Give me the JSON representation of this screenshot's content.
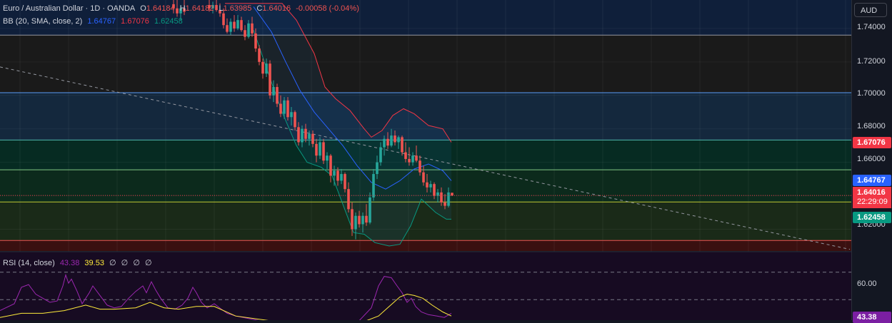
{
  "header": {
    "symbol": "Euro / Australian Dollar · 1D · OANDA",
    "o_label": "O",
    "o_value": "1.64184",
    "h_label": "H",
    "h_value": "1.64182",
    "l_label": "L",
    "l_value": "1.63985",
    "c_label": "C",
    "c_value": "1.64016",
    "change": "-0.00058 (-0.04%)"
  },
  "bb": {
    "label": "BB (20, SMA, close, 2)",
    "basis": "1.64767",
    "upper": "1.67076",
    "lower": "1.62458"
  },
  "rsi": {
    "label": "RSI (14, close)",
    "value": "43.38",
    "ma_value": "39.53",
    "empty1": "∅",
    "empty2": "∅",
    "empty3": "∅",
    "empty4": "∅",
    "axis_label": "60.00",
    "badge": "43.38"
  },
  "price_axis": {
    "currency": "AUD",
    "ticks": [
      "1.74000",
      "1.72000",
      "1.70000",
      "1.68000",
      "1.66000",
      "1.62000"
    ],
    "upper_badge": "1.67076",
    "basis_badge": "1.64767",
    "current_price": "1.64016",
    "countdown": "22:29:09",
    "lower_badge": "1.62458"
  },
  "colors": {
    "background": "#131722",
    "bull": "#26a69a",
    "bear": "#ef5350",
    "bb_upper": "#f23645",
    "bb_basis": "#2962ff",
    "bb_lower": "#089981",
    "rsi": "#9c27b0",
    "rsi_ma": "#ffeb3b"
  },
  "chart_data": {
    "type": "candlestick",
    "instrument": "Euro / Australian Dollar",
    "timeframe": "1D",
    "ylim": [
      1.607,
      1.757
    ],
    "zones": [
      {
        "from": 1.736,
        "to": 1.757,
        "color": "#0f1f3a"
      },
      {
        "from": 1.7016,
        "to": 1.736,
        "color": "#1a1a1a"
      },
      {
        "from": 1.6733,
        "to": 1.7016,
        "color": "#14283d"
      },
      {
        "from": 1.6555,
        "to": 1.6733,
        "color": "#062b22"
      },
      {
        "from": 1.6363,
        "to": 1.6555,
        "color": "#0c2a1c"
      },
      {
        "from": 1.6133,
        "to": 1.6363,
        "color": "#1a2a18"
      },
      {
        "from": 1.607,
        "to": 1.6133,
        "color": "#3a1010"
      }
    ],
    "levels": [
      {
        "price": 1.736,
        "color": "#9598a1"
      },
      {
        "price": 1.7016,
        "color": "#5b9cf6"
      },
      {
        "price": 1.6733,
        "color": "#4db6ac"
      },
      {
        "price": 1.6555,
        "color": "#81c784"
      },
      {
        "price": 1.6363,
        "color": "#c0ca33"
      },
      {
        "price": 1.6133,
        "color": "#ef5350"
      }
    ],
    "trendline": {
      "from": [
        0,
        1.717
      ],
      "to": [
        1190,
        1.608
      ]
    },
    "bb_upper": [
      [
        315,
        1.755
      ],
      [
        370,
        1.755
      ],
      [
        395,
        1.755
      ],
      [
        415,
        1.745
      ],
      [
        440,
        1.725
      ],
      [
        455,
        1.705
      ],
      [
        470,
        1.698
      ],
      [
        490,
        1.691
      ],
      [
        510,
        1.68
      ],
      [
        520,
        1.675
      ],
      [
        535,
        1.679
      ],
      [
        550,
        1.688
      ],
      [
        565,
        1.692
      ],
      [
        580,
        1.689
      ],
      [
        600,
        1.682
      ],
      [
        620,
        1.68
      ],
      [
        632,
        1.672
      ]
    ],
    "bb_basis": [
      [
        355,
        1.753
      ],
      [
        380,
        1.738
      ],
      [
        400,
        1.72
      ],
      [
        420,
        1.703
      ],
      [
        440,
        1.69
      ],
      [
        460,
        1.68
      ],
      [
        480,
        1.67
      ],
      [
        500,
        1.658
      ],
      [
        520,
        1.648
      ],
      [
        540,
        1.644
      ],
      [
        560,
        1.649
      ],
      [
        580,
        1.656
      ],
      [
        600,
        1.659
      ],
      [
        620,
        1.655
      ],
      [
        632,
        1.649
      ]
    ],
    "bb_lower": [
      [
        355,
        1.739
      ],
      [
        375,
        1.714
      ],
      [
        395,
        1.69
      ],
      [
        415,
        1.67
      ],
      [
        430,
        1.66
      ],
      [
        450,
        1.657
      ],
      [
        465,
        1.652
      ],
      [
        480,
        1.635
      ],
      [
        495,
        1.618
      ],
      [
        510,
        1.617
      ],
      [
        525,
        1.612
      ],
      [
        545,
        1.61
      ],
      [
        560,
        1.611
      ],
      [
        575,
        1.622
      ],
      [
        590,
        1.638
      ],
      [
        610,
        1.63
      ],
      [
        625,
        1.626
      ],
      [
        632,
        1.626
      ]
    ],
    "candles": [
      [
        243,
        1.7545,
        1.757,
        1.749,
        1.752
      ],
      [
        248,
        1.752,
        1.757,
        1.747,
        1.749
      ],
      [
        253,
        1.749,
        1.754,
        1.745,
        1.752
      ],
      [
        258,
        1.752,
        1.757,
        1.748,
        1.75
      ],
      [
        293,
        1.754,
        1.757,
        1.75,
        1.752
      ],
      [
        298,
        1.752,
        1.756,
        1.749,
        1.754
      ],
      [
        303,
        1.754,
        1.757,
        1.75,
        1.751
      ],
      [
        308,
        1.751,
        1.755,
        1.747,
        1.749
      ],
      [
        313,
        1.749,
        1.752,
        1.74,
        1.742
      ],
      [
        318,
        1.742,
        1.746,
        1.737,
        1.738
      ],
      [
        323,
        1.738,
        1.746,
        1.736,
        1.744
      ],
      [
        328,
        1.744,
        1.748,
        1.738,
        1.74
      ],
      [
        333,
        1.74,
        1.748,
        1.739,
        1.745
      ],
      [
        338,
        1.745,
        1.747,
        1.738,
        1.739
      ],
      [
        343,
        1.739,
        1.742,
        1.733,
        1.735
      ],
      [
        348,
        1.735,
        1.745,
        1.734,
        1.743
      ],
      [
        353,
        1.743,
        1.747,
        1.735,
        1.737
      ],
      [
        358,
        1.737,
        1.74,
        1.726,
        1.728
      ],
      [
        363,
        1.728,
        1.73,
        1.718,
        1.72
      ],
      [
        368,
        1.72,
        1.722,
        1.71,
        1.713
      ],
      [
        373,
        1.713,
        1.722,
        1.711,
        1.719
      ],
      [
        378,
        1.719,
        1.721,
        1.698,
        1.7
      ],
      [
        383,
        1.7,
        1.709,
        1.696,
        1.705
      ],
      [
        388,
        1.705,
        1.707,
        1.693,
        1.695
      ],
      [
        393,
        1.695,
        1.7,
        1.687,
        1.689
      ],
      [
        398,
        1.689,
        1.699,
        1.686,
        1.697
      ],
      [
        403,
        1.697,
        1.699,
        1.685,
        1.687
      ],
      [
        408,
        1.687,
        1.693,
        1.682,
        1.69
      ],
      [
        413,
        1.69,
        1.691,
        1.679,
        1.681
      ],
      [
        418,
        1.681,
        1.684,
        1.67,
        1.672
      ],
      [
        423,
        1.672,
        1.682,
        1.669,
        1.68
      ],
      [
        428,
        1.68,
        1.683,
        1.672,
        1.674
      ],
      [
        433,
        1.674,
        1.679,
        1.67,
        1.677
      ],
      [
        438,
        1.677,
        1.679,
        1.669,
        1.671
      ],
      [
        443,
        1.671,
        1.674,
        1.66,
        1.664
      ],
      [
        448,
        1.664,
        1.675,
        1.662,
        1.672
      ],
      [
        453,
        1.672,
        1.674,
        1.659,
        1.661
      ],
      [
        458,
        1.661,
        1.666,
        1.656,
        1.664
      ],
      [
        463,
        1.664,
        1.665,
        1.648,
        1.652
      ],
      [
        468,
        1.652,
        1.658,
        1.646,
        1.655
      ],
      [
        473,
        1.655,
        1.657,
        1.646,
        1.649
      ],
      [
        478,
        1.649,
        1.656,
        1.647,
        1.653
      ],
      [
        483,
        1.653,
        1.654,
        1.642,
        1.644
      ],
      [
        488,
        1.644,
        1.648,
        1.63,
        1.632
      ],
      [
        493,
        1.632,
        1.636,
        1.616,
        1.62
      ],
      [
        498,
        1.62,
        1.63,
        1.614,
        1.628
      ],
      [
        503,
        1.628,
        1.631,
        1.621,
        1.623
      ],
      [
        508,
        1.623,
        1.63,
        1.618,
        1.628
      ],
      [
        513,
        1.628,
        1.635,
        1.622,
        1.624
      ],
      [
        518,
        1.624,
        1.642,
        1.623,
        1.639
      ],
      [
        523,
        1.639,
        1.656,
        1.637,
        1.653
      ],
      [
        528,
        1.653,
        1.664,
        1.65,
        1.66
      ],
      [
        533,
        1.66,
        1.672,
        1.658,
        1.669
      ],
      [
        538,
        1.669,
        1.676,
        1.664,
        1.674
      ],
      [
        543,
        1.674,
        1.678,
        1.668,
        1.67
      ],
      [
        548,
        1.67,
        1.68,
        1.669,
        1.676
      ],
      [
        553,
        1.676,
        1.679,
        1.67,
        1.672
      ],
      [
        558,
        1.672,
        1.676,
        1.668,
        1.675
      ],
      [
        563,
        1.675,
        1.676,
        1.664,
        1.666
      ],
      [
        568,
        1.666,
        1.672,
        1.66,
        1.662
      ],
      [
        573,
        1.662,
        1.669,
        1.658,
        1.66
      ],
      [
        578,
        1.66,
        1.666,
        1.658,
        1.664
      ],
      [
        583,
        1.664,
        1.67,
        1.66,
        1.661
      ],
      [
        588,
        1.661,
        1.664,
        1.652,
        1.654
      ],
      [
        593,
        1.654,
        1.658,
        1.646,
        1.648
      ],
      [
        598,
        1.648,
        1.653,
        1.642,
        1.645
      ],
      [
        603,
        1.645,
        1.649,
        1.642,
        1.647
      ],
      [
        608,
        1.647,
        1.648,
        1.638,
        1.64
      ],
      [
        613,
        1.64,
        1.644,
        1.636,
        1.642
      ],
      [
        618,
        1.642,
        1.645,
        1.634,
        1.636
      ],
      [
        623,
        1.636,
        1.641,
        1.632,
        1.634
      ],
      [
        628,
        1.634,
        1.645,
        1.633,
        1.642
      ],
      [
        633,
        1.6418,
        1.6418,
        1.6398,
        1.6402
      ]
    ],
    "rsi_pane": {
      "ylim": [
        35,
        85
      ],
      "levels": [
        70,
        50
      ],
      "rsi": [
        [
          0,
          42
        ],
        [
          20,
          47
        ],
        [
          30,
          59
        ],
        [
          40,
          61
        ],
        [
          50,
          54
        ],
        [
          60,
          51
        ],
        [
          70,
          48
        ],
        [
          80,
          49
        ],
        [
          88,
          60
        ],
        [
          92,
          68
        ],
        [
          96,
          62
        ],
        [
          100,
          65
        ],
        [
          108,
          56
        ],
        [
          115,
          47
        ],
        [
          125,
          55
        ],
        [
          130,
          60
        ],
        [
          140,
          53
        ],
        [
          150,
          46
        ],
        [
          160,
          44
        ],
        [
          170,
          45
        ],
        [
          180,
          51
        ],
        [
          190,
          56
        ],
        [
          200,
          60
        ],
        [
          205,
          55
        ],
        [
          212,
          63
        ],
        [
          218,
          57
        ],
        [
          225,
          51
        ],
        [
          235,
          44
        ],
        [
          245,
          43
        ],
        [
          255,
          46
        ],
        [
          263,
          51
        ],
        [
          270,
          59
        ],
        [
          275,
          55
        ],
        [
          282,
          48
        ],
        [
          290,
          44
        ],
        [
          300,
          47
        ],
        [
          310,
          43
        ],
        [
          318,
          40
        ],
        [
          330,
          38
        ],
        [
          350,
          36
        ],
        [
          380,
          33
        ],
        [
          420,
          32
        ],
        [
          460,
          31
        ],
        [
          500,
          33
        ],
        [
          520,
          44
        ],
        [
          530,
          60
        ],
        [
          538,
          67
        ],
        [
          548,
          66
        ],
        [
          556,
          60
        ],
        [
          563,
          55
        ],
        [
          570,
          48
        ],
        [
          576,
          51
        ],
        [
          582,
          45
        ],
        [
          590,
          41
        ],
        [
          600,
          39
        ],
        [
          612,
          38
        ],
        [
          622,
          37
        ],
        [
          632,
          40
        ]
      ],
      "rsi_ma": [
        [
          0,
          37
        ],
        [
          30,
          40
        ],
        [
          60,
          40
        ],
        [
          90,
          42
        ],
        [
          120,
          46
        ],
        [
          140,
          43
        ],
        [
          160,
          43
        ],
        [
          190,
          44
        ],
        [
          210,
          48
        ],
        [
          230,
          44
        ],
        [
          250,
          43
        ],
        [
          275,
          45
        ],
        [
          300,
          45
        ],
        [
          330,
          38
        ],
        [
          400,
          33
        ],
        [
          460,
          32
        ],
        [
          510,
          34
        ],
        [
          530,
          38
        ],
        [
          545,
          45
        ],
        [
          560,
          52
        ],
        [
          570,
          54
        ],
        [
          580,
          53
        ],
        [
          592,
          51
        ],
        [
          605,
          46
        ],
        [
          620,
          41
        ],
        [
          632,
          38
        ]
      ]
    }
  }
}
